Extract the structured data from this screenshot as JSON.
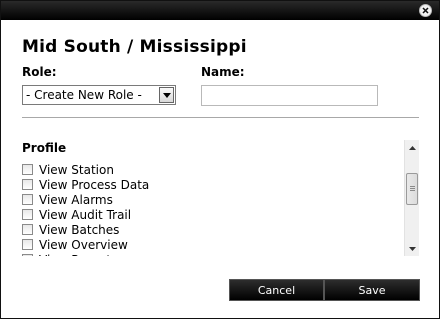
{
  "dialog": {
    "heading": "Mid South / Mississippi",
    "role_label": "Role:",
    "role_selected": "- Create New Role -",
    "name_label": "Name:",
    "name_value": "",
    "permissions_title": "Profile",
    "permissions": [
      {
        "label": "View Station",
        "checked": false
      },
      {
        "label": "View Process Data",
        "checked": false
      },
      {
        "label": "View Alarms",
        "checked": false
      },
      {
        "label": "View Audit Trail",
        "checked": false
      },
      {
        "label": "View Batches",
        "checked": false
      },
      {
        "label": "View Overview",
        "checked": false
      },
      {
        "label": "View Reports",
        "checked": false
      }
    ],
    "cancel_label": "Cancel",
    "save_label": "Save"
  },
  "icons": {
    "close": "close-icon",
    "dropdown": "chevron-down-icon",
    "scroll_up": "arrow-up-icon",
    "scroll_down": "arrow-down-icon"
  },
  "colors": {
    "titlebar": "#000000",
    "button_bg": "#111111",
    "button_text": "#ffffff"
  }
}
